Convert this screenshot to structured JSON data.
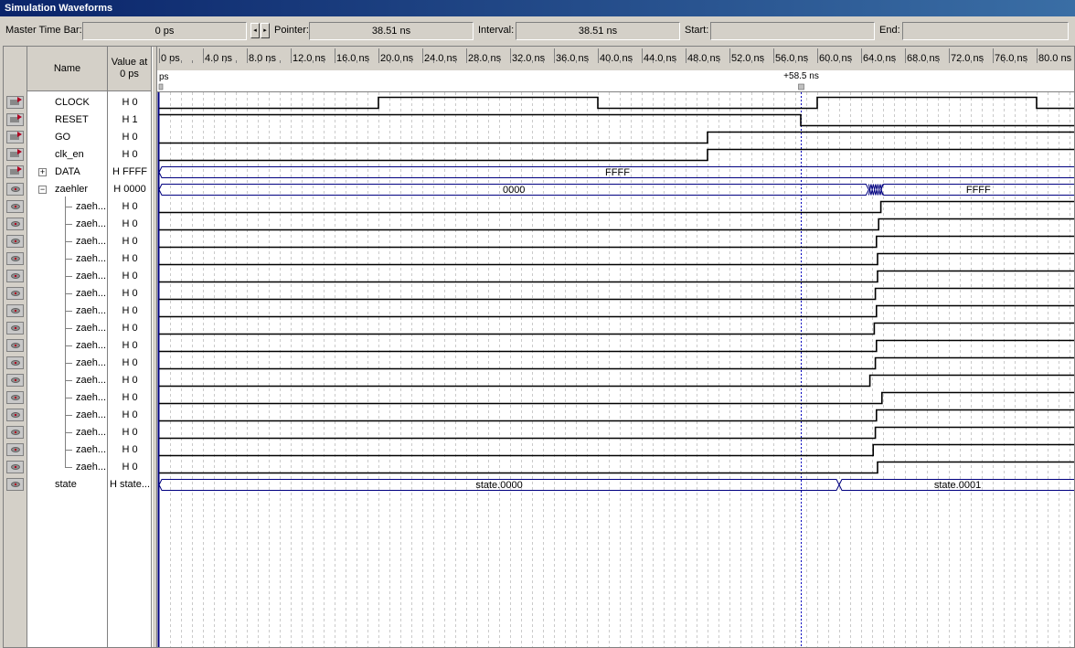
{
  "window": {
    "title": "Simulation Waveforms"
  },
  "toolbar": {
    "master_label": "Master Time Bar:",
    "master_value": "0 ps",
    "pointer_label": "Pointer:",
    "pointer_value": "38.51 ns",
    "interval_label": "Interval:",
    "interval_value": "38.51 ns",
    "start_label": "Start:",
    "start_value": "",
    "end_label": "End:",
    "end_value": "",
    "spin_left": "◂",
    "spin_right": "▸"
  },
  "columns": {
    "name": "Name",
    "value_line1": "Value at",
    "value_line2": "0 ps"
  },
  "timeline": {
    "ticks": [
      "0 ps",
      "4.0 ns",
      "8.0 ns",
      "12.0 ns",
      "16.0 ns",
      "20.0 ns",
      "24.0 ns",
      "28.0 ns",
      "32.0 ns",
      "36.0 ns",
      "40.0 ns",
      "44.0 ns",
      "48.0 ns",
      "52.0 ns",
      "56.0 ns",
      "60.0 ns",
      "64.0 ns",
      "68.0 ns",
      "72.0 ns",
      "76.0 ns",
      "80.0 ns"
    ],
    "start_marker_label": "ps",
    "cursor_label": "+58.5 ns",
    "cursor_ns": 58.5
  },
  "signals": [
    {
      "name": "CLOCK",
      "value": "H 0",
      "dir": "in",
      "kind": "bit",
      "edges": [
        [
          0,
          0
        ],
        [
          20,
          1
        ],
        [
          40,
          0
        ],
        [
          60,
          1
        ],
        [
          80,
          0
        ]
      ]
    },
    {
      "name": "RESET",
      "value": "H 1",
      "dir": "in",
      "kind": "bit",
      "edges": [
        [
          0,
          1
        ],
        [
          58.5,
          0
        ]
      ]
    },
    {
      "name": "GO",
      "value": "H 0",
      "dir": "in",
      "kind": "bit",
      "edges": [
        [
          0,
          0
        ],
        [
          50,
          1
        ]
      ]
    },
    {
      "name": "clk_en",
      "value": "H 0",
      "dir": "in",
      "kind": "bit",
      "edges": [
        [
          0,
          0
        ],
        [
          50,
          1
        ]
      ]
    },
    {
      "name": "DATA",
      "value": "H FFFF",
      "dir": "in",
      "kind": "bus",
      "expand": "+",
      "segments": [
        {
          "from": 0,
          "to": 84,
          "label": "FFFF"
        }
      ]
    },
    {
      "name": "zaehler",
      "value": "H 0000",
      "dir": "out",
      "kind": "bus",
      "expand": "−",
      "segments": [
        {
          "from": 0,
          "to": 64.7,
          "label": "0000"
        },
        {
          "from": 65.8,
          "to": 84,
          "label": "FFFF"
        }
      ]
    },
    {
      "name": "zaeh...",
      "value": "H 0",
      "dir": "out",
      "kind": "bit",
      "child": true,
      "edges": [
        [
          0,
          0
        ],
        [
          65.8,
          1
        ]
      ]
    },
    {
      "name": "zaeh...",
      "value": "H 0",
      "dir": "out",
      "kind": "bit",
      "child": true,
      "edges": [
        [
          0,
          0
        ],
        [
          65.6,
          1
        ]
      ]
    },
    {
      "name": "zaeh...",
      "value": "H 0",
      "dir": "out",
      "kind": "bit",
      "child": true,
      "edges": [
        [
          0,
          0
        ],
        [
          65.4,
          1
        ]
      ]
    },
    {
      "name": "zaeh...",
      "value": "H 0",
      "dir": "out",
      "kind": "bit",
      "child": true,
      "edges": [
        [
          0,
          0
        ],
        [
          65.5,
          1
        ]
      ]
    },
    {
      "name": "zaeh...",
      "value": "H 0",
      "dir": "out",
      "kind": "bit",
      "child": true,
      "edges": [
        [
          0,
          0
        ],
        [
          65.5,
          1
        ]
      ]
    },
    {
      "name": "zaeh...",
      "value": "H 0",
      "dir": "out",
      "kind": "bit",
      "child": true,
      "edges": [
        [
          0,
          0
        ],
        [
          65.3,
          1
        ]
      ]
    },
    {
      "name": "zaeh...",
      "value": "H 0",
      "dir": "out",
      "kind": "bit",
      "child": true,
      "edges": [
        [
          0,
          0
        ],
        [
          65.4,
          1
        ]
      ]
    },
    {
      "name": "zaeh...",
      "value": "H 0",
      "dir": "out",
      "kind": "bit",
      "child": true,
      "edges": [
        [
          0,
          0
        ],
        [
          65.2,
          1
        ]
      ]
    },
    {
      "name": "zaeh...",
      "value": "H 0",
      "dir": "out",
      "kind": "bit",
      "child": true,
      "edges": [
        [
          0,
          0
        ],
        [
          65.4,
          1
        ]
      ]
    },
    {
      "name": "zaeh...",
      "value": "H 0",
      "dir": "out",
      "kind": "bit",
      "child": true,
      "edges": [
        [
          0,
          0
        ],
        [
          65.3,
          1
        ]
      ]
    },
    {
      "name": "zaeh...",
      "value": "H 0",
      "dir": "out",
      "kind": "bit",
      "child": true,
      "edges": [
        [
          0,
          0
        ],
        [
          64.8,
          1
        ]
      ]
    },
    {
      "name": "zaeh...",
      "value": "H 0",
      "dir": "out",
      "kind": "bit",
      "child": true,
      "edges": [
        [
          0,
          0
        ],
        [
          65.9,
          1
        ]
      ]
    },
    {
      "name": "zaeh...",
      "value": "H 0",
      "dir": "out",
      "kind": "bit",
      "child": true,
      "edges": [
        [
          0,
          0
        ],
        [
          65.4,
          1
        ]
      ]
    },
    {
      "name": "zaeh...",
      "value": "H 0",
      "dir": "out",
      "kind": "bit",
      "child": true,
      "edges": [
        [
          0,
          0
        ],
        [
          65.3,
          1
        ]
      ]
    },
    {
      "name": "zaeh...",
      "value": "H 0",
      "dir": "out",
      "kind": "bit",
      "child": true,
      "edges": [
        [
          0,
          0
        ],
        [
          65.1,
          1
        ]
      ]
    },
    {
      "name": "zaeh...",
      "value": "H 0",
      "dir": "out",
      "kind": "bit",
      "child": true,
      "edges": [
        [
          0,
          0
        ],
        [
          65.5,
          1
        ]
      ]
    },
    {
      "name": "state",
      "value": "H state...",
      "dir": "out",
      "kind": "bus",
      "segments": [
        {
          "from": 0,
          "to": 62,
          "label": "state.0000"
        },
        {
          "from": 62,
          "to": 84,
          "label": "state.0001"
        }
      ]
    }
  ],
  "colors": {
    "wave": "#000000",
    "bus": "#000080",
    "cursor": "#0000c0",
    "grid": "#a8a8a8"
  }
}
